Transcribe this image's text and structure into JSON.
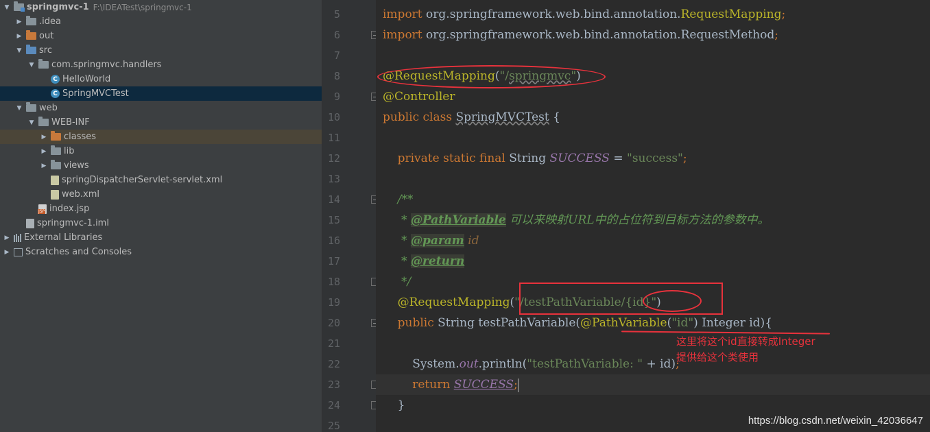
{
  "project_tree": [
    {
      "label": "springmvc-1",
      "path": "F:\\IDEATest\\springmvc-1",
      "icon": "module-folder-icon",
      "expanded": true,
      "depth": 0
    },
    {
      "label": ".idea",
      "icon": "folder-icon",
      "expanded": false,
      "depth": 1
    },
    {
      "label": "out",
      "icon": "orange-folder-icon",
      "expanded": false,
      "depth": 1
    },
    {
      "label": "src",
      "icon": "source-folder-icon",
      "expanded": true,
      "depth": 1
    },
    {
      "label": "com.springmvc.handlers",
      "icon": "package-icon",
      "expanded": true,
      "depth": 2
    },
    {
      "label": "HelloWorld",
      "icon": "class-icon",
      "depth": 3
    },
    {
      "label": "SpringMVCTest",
      "icon": "class-icon",
      "depth": 3,
      "selected": true
    },
    {
      "label": "web",
      "icon": "folder-icon",
      "expanded": true,
      "depth": 1
    },
    {
      "label": "WEB-INF",
      "icon": "folder-icon",
      "expanded": true,
      "depth": 2
    },
    {
      "label": "classes",
      "icon": "orange-folder-icon",
      "expanded": false,
      "depth": 3,
      "highlighted": true
    },
    {
      "label": "lib",
      "icon": "folder-icon",
      "expanded": false,
      "depth": 3
    },
    {
      "label": "views",
      "icon": "folder-icon",
      "expanded": false,
      "depth": 3
    },
    {
      "label": "springDispatcherServlet-servlet.xml",
      "icon": "xml-file-icon",
      "depth": 3
    },
    {
      "label": "web.xml",
      "icon": "xml-file-icon",
      "depth": 3
    },
    {
      "label": "index.jsp",
      "icon": "jsp-file-icon",
      "depth": 2
    },
    {
      "label": "springmvc-1.iml",
      "icon": "iml-file-icon",
      "depth": 1
    },
    {
      "label": "External Libraries",
      "icon": "libraries-icon",
      "expanded": false,
      "depth": 0
    },
    {
      "label": "Scratches and Consoles",
      "icon": "scratches-icon",
      "expanded": false,
      "depth": 0
    }
  ],
  "editor": {
    "line_numbers": [
      "5",
      "6",
      "7",
      "8",
      "9",
      "10",
      "11",
      "12",
      "13",
      "14",
      "15",
      "16",
      "17",
      "18",
      "19",
      "20",
      "21",
      "22",
      "23",
      "24",
      "25"
    ],
    "lines": [
      [
        {
          "t": "import ",
          "c": "kw"
        },
        {
          "t": "org.springframework.web.bind.annotation.",
          "c": ""
        },
        {
          "t": "RequestMapping",
          "c": "ann"
        },
        {
          "t": ";",
          "c": "kw"
        }
      ],
      [
        {
          "t": "import ",
          "c": "kw"
        },
        {
          "t": "org.springframework.web.bind.annotation.RequestMethod",
          "c": ""
        },
        {
          "t": ";",
          "c": "kw"
        }
      ],
      [],
      [
        {
          "t": "@RequestMapping",
          "c": "ann"
        },
        {
          "t": "(",
          "c": ""
        },
        {
          "t": "\"/",
          "c": "str"
        },
        {
          "t": "springmvc",
          "c": "str wavy"
        },
        {
          "t": "\"",
          "c": "str"
        },
        {
          "t": ")",
          "c": ""
        }
      ],
      [
        {
          "t": "@Controller",
          "c": "ann"
        }
      ],
      [
        {
          "t": "public ",
          "c": "kw"
        },
        {
          "t": "class ",
          "c": "kw"
        },
        {
          "t": "SpringMVCTest",
          "c": "wavy"
        },
        {
          "t": " {",
          "c": ""
        }
      ],
      [],
      [
        {
          "t": "    private ",
          "c": "kw"
        },
        {
          "t": "static ",
          "c": "kw"
        },
        {
          "t": "final ",
          "c": "kw"
        },
        {
          "t": "String ",
          "c": ""
        },
        {
          "t": "SUCCESS",
          "c": "const"
        },
        {
          "t": " = ",
          "c": ""
        },
        {
          "t": "\"success\"",
          "c": "str"
        },
        {
          "t": ";",
          "c": "kw"
        }
      ],
      [],
      [
        {
          "t": "    /**",
          "c": "doc"
        }
      ],
      [
        {
          "t": "     * ",
          "c": "doc"
        },
        {
          "t": "@PathVariable",
          "c": "doctag"
        },
        {
          "t": " 可以来映射URL中的占位符到目标方法的参数中。",
          "c": "doc"
        }
      ],
      [
        {
          "t": "     * ",
          "c": "doc"
        },
        {
          "t": "@param",
          "c": "doctag"
        },
        {
          "t": " ",
          "c": "doc"
        },
        {
          "t": "id",
          "c": "docp"
        }
      ],
      [
        {
          "t": "     * ",
          "c": "doc"
        },
        {
          "t": "@return",
          "c": "doctag"
        }
      ],
      [
        {
          "t": "     */",
          "c": "doc"
        }
      ],
      [
        {
          "t": "    @RequestMapping",
          "c": "ann"
        },
        {
          "t": "(",
          "c": ""
        },
        {
          "t": "\"/testPathVariable/{id}\"",
          "c": "str"
        },
        {
          "t": ")",
          "c": ""
        }
      ],
      [
        {
          "t": "    public ",
          "c": "kw"
        },
        {
          "t": "String ",
          "c": ""
        },
        {
          "t": "testPathVariable",
          "c": ""
        },
        {
          "t": "(",
          "c": ""
        },
        {
          "t": "@PathVariable",
          "c": "ann"
        },
        {
          "t": "(",
          "c": ""
        },
        {
          "t": "\"id\"",
          "c": "str"
        },
        {
          "t": ") Integer id){",
          "c": ""
        }
      ],
      [],
      [
        {
          "t": "        System.",
          "c": ""
        },
        {
          "t": "out",
          "c": "sfield"
        },
        {
          "t": ".println(",
          "c": ""
        },
        {
          "t": "\"testPathVariable: \"",
          "c": "str"
        },
        {
          "t": " + id)",
          "c": ""
        },
        {
          "t": ";",
          "c": "kw"
        }
      ],
      [
        {
          "t": "        return ",
          "c": "kw"
        },
        {
          "t": "SUCCESS",
          "c": "const udl"
        },
        {
          "t": ";",
          "c": "kw"
        }
      ],
      [
        {
          "t": "    }",
          "c": ""
        }
      ],
      []
    ]
  },
  "annotations": {
    "note_line1": "这里将这个id直接转成Integer",
    "note_line2": "提供给这个类使用"
  },
  "watermark": "https://blog.csdn.net/weixin_42036647",
  "colors": {
    "keyword": "#cc7832",
    "annotation": "#bbb529",
    "string": "#6a8759",
    "constant": "#9876aa",
    "doc_comment": "#629755",
    "markup_red": "#e8323c",
    "selected_row": "#0d293e"
  }
}
